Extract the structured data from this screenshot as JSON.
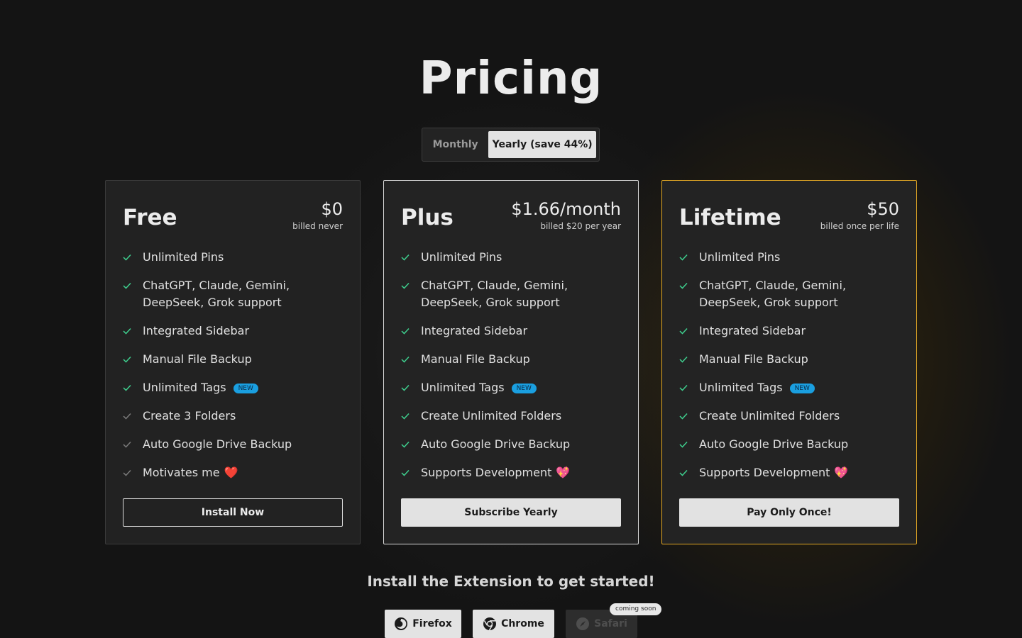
{
  "page": {
    "title": "Pricing"
  },
  "billing_toggle": {
    "monthly_label": "Monthly",
    "yearly_label": "Yearly (save 44%)",
    "selected": "yearly"
  },
  "plans": [
    {
      "name": "Free",
      "price": "$0",
      "billing": "billed never",
      "features": [
        {
          "text": "Unlimited Pins"
        },
        {
          "text": "ChatGPT, Claude, Gemini, DeepSeek, Grok support"
        },
        {
          "text": "Integrated Sidebar"
        },
        {
          "text": "Manual File Backup"
        },
        {
          "text": "Unlimited Tags",
          "badge": "NEW"
        },
        {
          "text": "Create 3 Folders",
          "muted_check": true
        },
        {
          "text": "Auto Google Drive Backup",
          "muted_check": true
        },
        {
          "text": "Motivates me",
          "emoji": "❤️",
          "muted_check": true
        }
      ],
      "button_label": "Install Now"
    },
    {
      "name": "Plus",
      "price": "$1.66/month",
      "billing": "billed $20 per year",
      "features": [
        {
          "text": "Unlimited Pins"
        },
        {
          "text": "ChatGPT, Claude, Gemini, DeepSeek, Grok support"
        },
        {
          "text": "Integrated Sidebar"
        },
        {
          "text": "Manual File Backup"
        },
        {
          "text": "Unlimited Tags",
          "badge": "NEW"
        },
        {
          "text": "Create Unlimited Folders"
        },
        {
          "text": "Auto Google Drive Backup"
        },
        {
          "text": "Supports Development",
          "emoji": "💖"
        }
      ],
      "button_label": "Subscribe Yearly"
    },
    {
      "name": "Lifetime",
      "price": "$50",
      "billing": "billed once per life",
      "features": [
        {
          "text": "Unlimited Pins"
        },
        {
          "text": "ChatGPT, Claude, Gemini, DeepSeek, Grok support"
        },
        {
          "text": "Integrated Sidebar"
        },
        {
          "text": "Manual File Backup"
        },
        {
          "text": "Unlimited Tags",
          "badge": "NEW"
        },
        {
          "text": "Create Unlimited Folders"
        },
        {
          "text": "Auto Google Drive Backup"
        },
        {
          "text": "Supports Development",
          "emoji": "💖"
        }
      ],
      "button_label": "Pay Only Once!"
    }
  ],
  "install": {
    "heading": "Install the Extension to get started!",
    "browsers": [
      {
        "label": "Firefox",
        "icon": "firefox-icon",
        "enabled": true
      },
      {
        "label": "Chrome",
        "icon": "chrome-icon",
        "enabled": true
      },
      {
        "label": "Safari",
        "icon": "safari-icon",
        "enabled": false,
        "tag": "coming soon"
      }
    ]
  },
  "colors": {
    "background": "#141414",
    "card": "#222222",
    "check_active": "#3ecf8e",
    "check_muted": "#7a7a7a",
    "badge": "#1a9fe0",
    "lifetime_border": "#e0a624",
    "plus_border": "#d9d9d9"
  }
}
